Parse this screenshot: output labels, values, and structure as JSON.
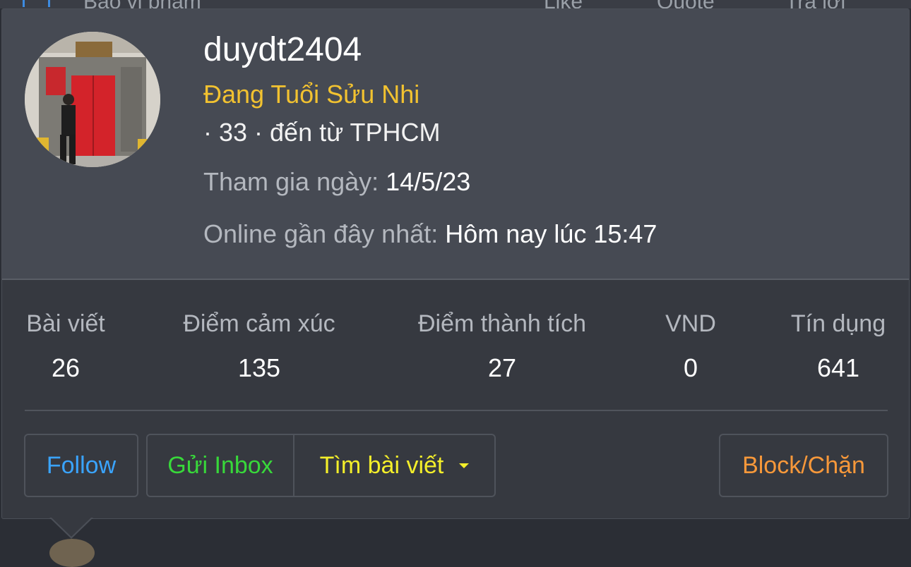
{
  "background": {
    "items": [
      "Báo vi phạm",
      "Like",
      "Quote",
      "Trả lời"
    ]
  },
  "profile": {
    "username": "duydt2404",
    "user_title": "Đang Tuổi Sửu Nhi",
    "meta": "· 33 · đến từ TPHCM",
    "joined_label": "Tham gia ngày:",
    "joined_value": "14/5/23",
    "lastseen_label": "Online gần đây nhất:",
    "lastseen_value": "Hôm nay lúc 15:47"
  },
  "stats": [
    {
      "label": "Bài viết",
      "value": "26"
    },
    {
      "label": "Điểm cảm xúc",
      "value": "135"
    },
    {
      "label": "Điểm thành tích",
      "value": "27"
    },
    {
      "label": "VND",
      "value": "0"
    },
    {
      "label": "Tín dụng",
      "value": "641"
    }
  ],
  "actions": {
    "follow": "Follow",
    "inbox": "Gửi Inbox",
    "find_posts": "Tìm bài viết",
    "block": "Block/Chặn"
  },
  "colors": {
    "follow": "#3aa4ff",
    "inbox": "#38d83a",
    "find_posts": "#f4ef2a",
    "block": "#f7983a",
    "user_title": "#f2c230"
  }
}
